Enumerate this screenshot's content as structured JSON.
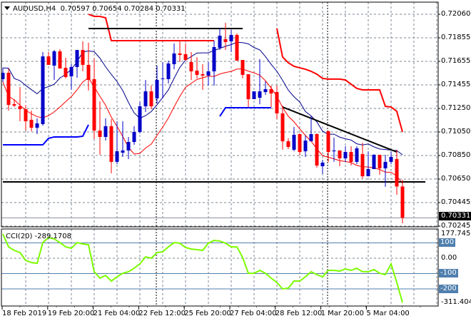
{
  "header": {
    "symbol": "AUDUSD,H4",
    "open": "0.70597",
    "high": "0.70654",
    "low": "0.70284",
    "close": "0.70331"
  },
  "price_axis": [
    "0.72060",
    "0.71855",
    "0.71655",
    "0.71455",
    "0.71250",
    "0.71050",
    "0.70850",
    "0.70650",
    "0.70445",
    "0.70245"
  ],
  "current_price": "0.70331",
  "cci": {
    "label": "CCI(20) -289.1708",
    "axis_labels": {
      "top": "177.7451",
      "l100": "100",
      "l0": "0.00",
      "lm100": "-100",
      "lm200": "-200",
      "bottom": "-311.4049"
    },
    "values": [
      158,
      74,
      51,
      37,
      -14,
      -28,
      -33,
      102,
      135,
      126,
      102,
      74,
      65,
      102,
      93,
      88,
      -88,
      -130,
      -112,
      -149,
      -121,
      -98,
      -88,
      -65,
      -37,
      9,
      0,
      37,
      42,
      74,
      102,
      98,
      70,
      60,
      56,
      51,
      98,
      116,
      112,
      98,
      74,
      74,
      5,
      -98,
      -98,
      -79,
      -98,
      -130,
      -158,
      -200,
      -195,
      -149,
      -149,
      -121,
      -88,
      -107,
      -121,
      -79,
      -79,
      -84,
      -70,
      -79,
      -65,
      -88,
      -88,
      -74,
      -98,
      -107,
      -37,
      -158,
      -289.17
    ]
  },
  "time_axis": [
    "18 Feb 2019",
    "19 Feb 20:00",
    "21 Feb 04:00",
    "22 Feb 12:00",
    "25 Feb 20:00",
    "27 Feb 04:00",
    "28 Feb 12:00",
    "1 Mar 20:00",
    "5 Mar 04:00"
  ],
  "colors": {
    "bull": "#0000c8",
    "bear": "#ff0000",
    "ma_upper": "#00008b",
    "ma_lower": "#ff0000",
    "support": "#0000ff",
    "stop": "#ff0000",
    "cci": "#7cfc00",
    "level": "#4f7fae",
    "grid": "#7a8593"
  },
  "chart_data": {
    "type": "candlestick",
    "candles": [
      [
        0.71509,
        0.71605,
        0.71485,
        0.71563
      ],
      [
        0.71563,
        0.71599,
        0.71242,
        0.7129
      ],
      [
        0.71296,
        0.71339,
        0.71272,
        0.71284
      ],
      [
        0.71278,
        0.71442,
        0.71151,
        0.71254
      ],
      [
        0.71254,
        0.7129,
        0.71072,
        0.71151
      ],
      [
        0.71163,
        0.71242,
        0.71066,
        0.71096
      ],
      [
        0.71096,
        0.71175,
        0.71042,
        0.71133
      ],
      [
        0.71127,
        0.71739,
        0.71115,
        0.71702
      ],
      [
        0.71702,
        0.71739,
        0.7163,
        0.7163
      ],
      [
        0.71624,
        0.71757,
        0.71502,
        0.71745
      ],
      [
        0.71745,
        0.71763,
        0.71599,
        0.71599
      ],
      [
        0.71605,
        0.7169,
        0.71515,
        0.71527
      ],
      [
        0.71533,
        0.71636,
        0.71418,
        0.71612
      ],
      [
        0.71612,
        0.71757,
        0.71521,
        0.71757
      ],
      [
        0.71757,
        0.7183,
        0.71575,
        0.7163
      ],
      [
        0.7163,
        0.71818,
        0.71412,
        0.71502
      ],
      [
        0.71509,
        0.71684,
        0.71,
        0.71072
      ],
      [
        0.71072,
        0.71321,
        0.70866,
        0.71018
      ],
      [
        0.71018,
        0.71175,
        0.70987,
        0.71109
      ],
      [
        0.71109,
        0.71169,
        0.70709,
        0.70806
      ],
      [
        0.70806,
        0.71151,
        0.70787,
        0.70896
      ],
      [
        0.70884,
        0.71151,
        0.70848,
        0.70903
      ],
      [
        0.70903,
        0.71018,
        0.7083,
        0.70975
      ],
      [
        0.70975,
        0.71109,
        0.70951,
        0.7106
      ],
      [
        0.7106,
        0.71315,
        0.71048,
        0.71278
      ],
      [
        0.71278,
        0.71502,
        0.7123,
        0.71405
      ],
      [
        0.71405,
        0.71454,
        0.71254,
        0.71278
      ],
      [
        0.71345,
        0.71624,
        0.71303,
        0.71502
      ],
      [
        0.71509,
        0.71654,
        0.71345,
        0.71515
      ],
      [
        0.71509,
        0.71666,
        0.71472,
        0.71642
      ],
      [
        0.71636,
        0.71812,
        0.71593,
        0.71727
      ],
      [
        0.71727,
        0.71842,
        0.71654,
        0.71715
      ],
      [
        0.71721,
        0.71812,
        0.71666,
        0.71672
      ],
      [
        0.71654,
        0.71739,
        0.71502,
        0.71575
      ],
      [
        0.71581,
        0.71696,
        0.71515,
        0.71545
      ],
      [
        0.71551,
        0.71636,
        0.71418,
        0.71539
      ],
      [
        0.71539,
        0.71654,
        0.71454,
        0.71575
      ],
      [
        0.71575,
        0.71836,
        0.71454,
        0.71781
      ],
      [
        0.71775,
        0.71945,
        0.71757,
        0.71878
      ],
      [
        0.71848,
        0.71987,
        0.71757,
        0.71824
      ],
      [
        0.7183,
        0.71927,
        0.71739,
        0.71884
      ],
      [
        0.71884,
        0.71896,
        0.71666,
        0.71666
      ],
      [
        0.71672,
        0.71672,
        0.71515,
        0.71545
      ],
      [
        0.71551,
        0.71551,
        0.71272,
        0.71339
      ],
      [
        0.71339,
        0.71405,
        0.71339,
        0.71405
      ],
      [
        0.71351,
        0.71678,
        0.71296,
        0.71405
      ],
      [
        0.71399,
        0.7149,
        0.71375,
        0.71424
      ],
      [
        0.71424,
        0.71454,
        0.71272,
        0.71387
      ],
      [
        0.71399,
        0.71454,
        0.71169,
        0.71218
      ],
      [
        0.71218,
        0.71284,
        0.70909,
        0.70981
      ],
      [
        0.70981,
        0.71006,
        0.70915,
        0.70933
      ],
      [
        0.70909,
        0.71103,
        0.70896,
        0.71036
      ],
      [
        0.71042,
        0.71048,
        0.7086,
        0.7089
      ],
      [
        0.70896,
        0.7103,
        0.70848,
        0.70987
      ],
      [
        0.70981,
        0.71193,
        0.70981,
        0.71042
      ],
      [
        0.71042,
        0.71048,
        0.70757,
        0.70775
      ],
      [
        0.70769,
        0.70824,
        0.70703,
        0.708
      ],
      [
        0.71066,
        0.71072,
        0.70806,
        0.7089
      ],
      [
        0.70896,
        0.71012,
        0.70806,
        0.70903
      ],
      [
        0.70903,
        0.70903,
        0.70769,
        0.70836
      ],
      [
        0.70836,
        0.70939,
        0.70806,
        0.7089
      ],
      [
        0.7089,
        0.70939,
        0.70775,
        0.70806
      ],
      [
        0.70806,
        0.70939,
        0.70787,
        0.70921
      ],
      [
        0.70872,
        0.70969,
        0.70666,
        0.70684
      ],
      [
        0.70684,
        0.70896,
        0.70684,
        0.70745
      ],
      [
        0.70745,
        0.70872,
        0.70745,
        0.70866
      ],
      [
        0.70866,
        0.70866,
        0.70697,
        0.70751
      ],
      [
        0.70751,
        0.70866,
        0.70594,
        0.70806
      ],
      [
        0.70806,
        0.70896,
        0.70787,
        0.70848
      ],
      [
        0.7083,
        0.70909,
        0.70527,
        0.70597
      ],
      [
        0.70597,
        0.70654,
        0.70284,
        0.70331
      ]
    ],
    "support_line": [
      0.70951,
      0.70951,
      0.70951,
      0.70951,
      0.70951,
      0.70951,
      0.70951,
      0.70951,
      0.71006,
      0.71018,
      0.71018,
      0.71018,
      0.71018,
      0.71018,
      0.71024,
      0.71121,
      null,
      null,
      null,
      null,
      null,
      null,
      null,
      null,
      null,
      null,
      null,
      null,
      null,
      null,
      null,
      null,
      null,
      null,
      null,
      null,
      null,
      null,
      0.71193,
      0.71266,
      0.71266,
      0.71266,
      0.71266,
      0.71266,
      0.71266,
      0.71266,
      0.71266,
      0.71266,
      null,
      null,
      null,
      null,
      null,
      null,
      null,
      null,
      null,
      null,
      null,
      null,
      null,
      null,
      null,
      null,
      null,
      null,
      null,
      null,
      null,
      null,
      null
    ],
    "stop_line": [
      null,
      null,
      null,
      null,
      null,
      null,
      null,
      null,
      null,
      null,
      null,
      null,
      null,
      null,
      null,
      0.7206,
      0.72042,
      0.72042,
      0.7203,
      0.71836,
      0.71836,
      0.71836,
      0.71836,
      0.71836,
      0.71836,
      0.71836,
      0.71836,
      0.71836,
      0.71836,
      0.71836,
      0.71836,
      0.71836,
      0.71836,
      0.71836,
      0.71836,
      0.71836,
      0.71836,
      0.71836,
      null,
      null,
      null,
      null,
      null,
      null,
      null,
      null,
      null,
      null,
      0.71939,
      0.71697,
      0.71648,
      0.71618,
      0.71605,
      0.71593,
      0.71575,
      0.71551,
      0.71515,
      0.71509,
      0.71509,
      0.71509,
      0.71502,
      0.71466,
      0.7143,
      0.71418,
      0.71418,
      0.71418,
      0.71418,
      0.71278,
      0.71272,
      0.71236,
      0.7106
    ],
    "hlines": [
      {
        "price": 0.71939,
        "from": 15,
        "to": 42
      },
      {
        "price": 0.70636,
        "from": 0,
        "to": 74
      }
    ],
    "trendline": {
      "from": [
        49,
        0.71272
      ],
      "to": [
        69,
        0.7089
      ]
    },
    "ylim": [
      0.70245,
      0.7206
    ],
    "cci_ylim": [
      -311.4049,
      177.7451
    ],
    "cci_levels": [
      100,
      0,
      -100,
      -200
    ]
  }
}
